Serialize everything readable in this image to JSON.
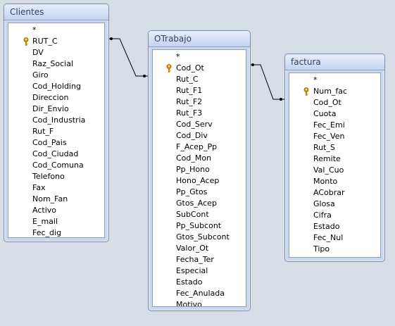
{
  "tables": {
    "clientes": {
      "title": "Clientes",
      "fields": [
        "*",
        "RUT_C",
        "DV",
        "Raz_Social",
        "Giro",
        "Cod_Holding",
        "Direccion",
        "Dir_Envio",
        "Cod_Industria",
        "Rut_F",
        "Cod_Pais",
        "Cod_Ciudad",
        "Cod_Comuna",
        "Telefono",
        "Fax",
        "Nom_Fan",
        "Activo",
        "E_mail",
        "Fec_dig"
      ],
      "key_field_index": 1
    },
    "otrabajo": {
      "title": "OTrabajo",
      "fields": [
        "*",
        "Cod_Ot",
        "Rut_C",
        "Rut_F1",
        "Rut_F2",
        "Rut_F3",
        "Cod_Serv",
        "Cod_Div",
        "F_Acep_Pp",
        "Cod_Mon",
        "Pp_Hono",
        "Hono_Acep",
        "Pp_Gtos",
        "Gtos_Acep",
        "SubCont",
        "Pp_Subcont",
        "Gtos_Subcont",
        "Valor_Ot",
        "Fecha_Ter",
        "Especial",
        "Estado",
        "Fec_Anulada",
        "Motivo"
      ],
      "key_field_index": 1
    },
    "factura": {
      "title": "factura",
      "fields": [
        "*",
        "Num_fac",
        "Cod_Ot",
        "Cuota",
        "Fec_Emi",
        "Fec_Ven",
        "Rut_S",
        "Remite",
        "Val_Cuo",
        "Monto",
        "ACobrar",
        "Glosa",
        "Cifra",
        "Estado",
        "Fec_Nul",
        "Tipo"
      ],
      "key_field_index": 1
    }
  },
  "icons": {
    "primary_key": "key-icon"
  },
  "colors": {
    "key_gold": "#d9a800",
    "background": "#d7dde6",
    "title_text": "#31415f"
  }
}
